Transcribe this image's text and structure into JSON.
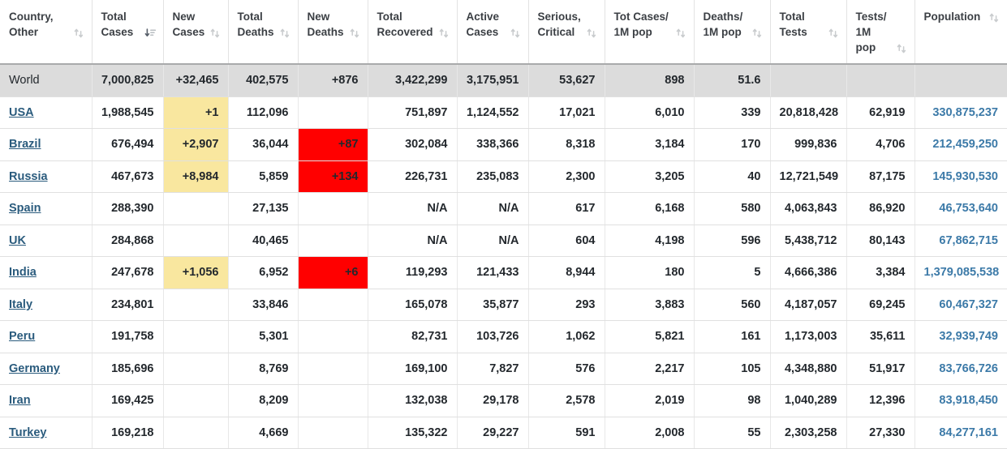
{
  "table": {
    "columns": [
      {
        "line1": "Country,",
        "line2": "Other",
        "sort": "both",
        "align": "left"
      },
      {
        "line1": "Total",
        "line2": "Cases",
        "sort": "desc-active",
        "align": "right"
      },
      {
        "line1": "New",
        "line2": "Cases",
        "sort": "both",
        "align": "right"
      },
      {
        "line1": "Total",
        "line2": "Deaths",
        "sort": "both",
        "align": "right"
      },
      {
        "line1": "New",
        "line2": "Deaths",
        "sort": "both",
        "align": "right"
      },
      {
        "line1": "Total",
        "line2": "Recovered",
        "sort": "both",
        "align": "right"
      },
      {
        "line1": "Active",
        "line2": "Cases",
        "sort": "both",
        "align": "right"
      },
      {
        "line1": "Serious,",
        "line2": "Critical",
        "sort": "both",
        "align": "right"
      },
      {
        "line1": "Tot Cases/",
        "line2": "1M pop",
        "sort": "both",
        "align": "right"
      },
      {
        "line1": "Deaths/",
        "line2": "1M pop",
        "sort": "both",
        "align": "right"
      },
      {
        "line1": "Total",
        "line2": "Tests",
        "sort": "both",
        "align": "right"
      },
      {
        "line1": "Tests/",
        "line2": "1M pop",
        "sort": "both",
        "align": "right"
      },
      {
        "line1": "Population",
        "line2": "",
        "sort": "both",
        "align": "right"
      }
    ],
    "total_row": {
      "country": "World",
      "total_cases": "7,000,825",
      "new_cases": "+32,465",
      "total_deaths": "402,575",
      "new_deaths": "+876",
      "total_recovered": "3,422,299",
      "active_cases": "3,175,951",
      "serious_critical": "53,627",
      "tot_cases_1m": "898",
      "deaths_1m": "51.6",
      "total_tests": "",
      "tests_1m": "",
      "population": ""
    },
    "rows": [
      {
        "country": "USA",
        "total_cases": "1,988,545",
        "new_cases": "+1",
        "new_cases_hl": "yellow",
        "total_deaths": "112,096",
        "new_deaths": "",
        "new_deaths_hl": "none",
        "total_recovered": "751,897",
        "active_cases": "1,124,552",
        "serious_critical": "17,021",
        "tot_cases_1m": "6,010",
        "deaths_1m": "339",
        "total_tests": "20,818,428",
        "tests_1m": "62,919",
        "population": "330,875,237"
      },
      {
        "country": "Brazil",
        "total_cases": "676,494",
        "new_cases": "+2,907",
        "new_cases_hl": "yellow",
        "total_deaths": "36,044",
        "new_deaths": "+87",
        "new_deaths_hl": "red",
        "total_recovered": "302,084",
        "active_cases": "338,366",
        "serious_critical": "8,318",
        "tot_cases_1m": "3,184",
        "deaths_1m": "170",
        "total_tests": "999,836",
        "tests_1m": "4,706",
        "population": "212,459,250"
      },
      {
        "country": "Russia",
        "total_cases": "467,673",
        "new_cases": "+8,984",
        "new_cases_hl": "yellow",
        "total_deaths": "5,859",
        "new_deaths": "+134",
        "new_deaths_hl": "red",
        "total_recovered": "226,731",
        "active_cases": "235,083",
        "serious_critical": "2,300",
        "tot_cases_1m": "3,205",
        "deaths_1m": "40",
        "total_tests": "12,721,549",
        "tests_1m": "87,175",
        "population": "145,930,530"
      },
      {
        "country": "Spain",
        "total_cases": "288,390",
        "new_cases": "",
        "new_cases_hl": "none",
        "total_deaths": "27,135",
        "new_deaths": "",
        "new_deaths_hl": "none",
        "total_recovered": "N/A",
        "active_cases": "N/A",
        "serious_critical": "617",
        "tot_cases_1m": "6,168",
        "deaths_1m": "580",
        "total_tests": "4,063,843",
        "tests_1m": "86,920",
        "population": "46,753,640"
      },
      {
        "country": "UK",
        "total_cases": "284,868",
        "new_cases": "",
        "new_cases_hl": "none",
        "total_deaths": "40,465",
        "new_deaths": "",
        "new_deaths_hl": "none",
        "total_recovered": "N/A",
        "active_cases": "N/A",
        "serious_critical": "604",
        "tot_cases_1m": "4,198",
        "deaths_1m": "596",
        "total_tests": "5,438,712",
        "tests_1m": "80,143",
        "population": "67,862,715"
      },
      {
        "country": "India",
        "total_cases": "247,678",
        "new_cases": "+1,056",
        "new_cases_hl": "yellow",
        "total_deaths": "6,952",
        "new_deaths": "+6",
        "new_deaths_hl": "red",
        "total_recovered": "119,293",
        "active_cases": "121,433",
        "serious_critical": "8,944",
        "tot_cases_1m": "180",
        "deaths_1m": "5",
        "total_tests": "4,666,386",
        "tests_1m": "3,384",
        "population": "1,379,085,538"
      },
      {
        "country": "Italy",
        "total_cases": "234,801",
        "new_cases": "",
        "new_cases_hl": "none",
        "total_deaths": "33,846",
        "new_deaths": "",
        "new_deaths_hl": "none",
        "total_recovered": "165,078",
        "active_cases": "35,877",
        "serious_critical": "293",
        "tot_cases_1m": "3,883",
        "deaths_1m": "560",
        "total_tests": "4,187,057",
        "tests_1m": "69,245",
        "population": "60,467,327"
      },
      {
        "country": "Peru",
        "total_cases": "191,758",
        "new_cases": "",
        "new_cases_hl": "none",
        "total_deaths": "5,301",
        "new_deaths": "",
        "new_deaths_hl": "none",
        "total_recovered": "82,731",
        "active_cases": "103,726",
        "serious_critical": "1,062",
        "tot_cases_1m": "5,821",
        "deaths_1m": "161",
        "total_tests": "1,173,003",
        "tests_1m": "35,611",
        "population": "32,939,749"
      },
      {
        "country": "Germany",
        "total_cases": "185,696",
        "new_cases": "",
        "new_cases_hl": "none",
        "total_deaths": "8,769",
        "new_deaths": "",
        "new_deaths_hl": "none",
        "total_recovered": "169,100",
        "active_cases": "7,827",
        "serious_critical": "576",
        "tot_cases_1m": "2,217",
        "deaths_1m": "105",
        "total_tests": "4,348,880",
        "tests_1m": "51,917",
        "population": "83,766,726"
      },
      {
        "country": "Iran",
        "total_cases": "169,425",
        "new_cases": "",
        "new_cases_hl": "none",
        "total_deaths": "8,209",
        "new_deaths": "",
        "new_deaths_hl": "none",
        "total_recovered": "132,038",
        "active_cases": "29,178",
        "serious_critical": "2,578",
        "tot_cases_1m": "2,019",
        "deaths_1m": "98",
        "total_tests": "1,040,289",
        "tests_1m": "12,396",
        "population": "83,918,450"
      },
      {
        "country": "Turkey",
        "total_cases": "169,218",
        "new_cases": "",
        "new_cases_hl": "none",
        "total_deaths": "4,669",
        "new_deaths": "",
        "new_deaths_hl": "none",
        "total_recovered": "135,322",
        "active_cases": "29,227",
        "serious_critical": "591",
        "tot_cases_1m": "2,008",
        "deaths_1m": "55",
        "total_tests": "2,303,258",
        "tests_1m": "27,330",
        "population": "84,277,161"
      }
    ]
  },
  "colors": {
    "highlight_new_cases": "#f9e79f",
    "highlight_new_deaths": "#ff0000",
    "total_row_bg": "#dcdcdc",
    "country_link": "#2a5b7d",
    "population_text": "#3c7aa8"
  }
}
